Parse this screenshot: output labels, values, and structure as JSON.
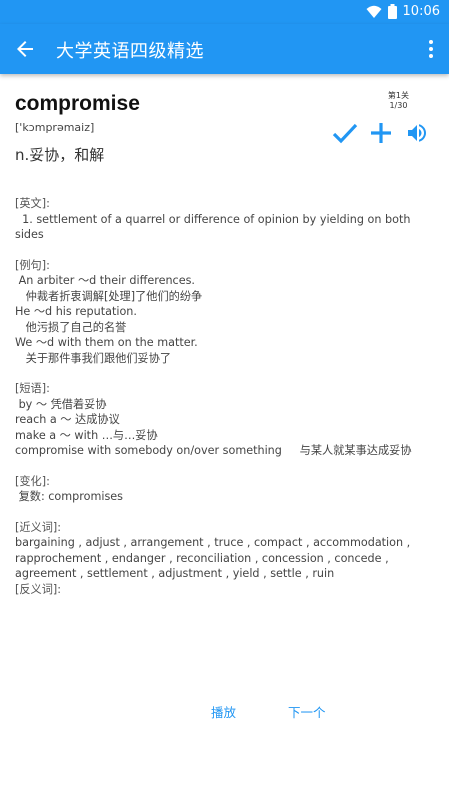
{
  "status": {
    "time": "10:06"
  },
  "app_bar": {
    "title": "大学英语四级精选"
  },
  "word": {
    "text": "compromise",
    "phonetic": "['kɔmprəmaiz]",
    "meaning": "n.妥协，和解"
  },
  "level": {
    "label": "第1关",
    "progress": "1/30"
  },
  "sections": {
    "english": {
      "header": "[英文]:",
      "lines": [
        "  1. settlement of a quarrel or difference of opinion by yielding on both sides"
      ]
    },
    "examples": {
      "header": "[例句]:",
      "lines": [
        " An arbiter ～d their differences.",
        "   仲裁者折衷调解[处理]了他们的纷争",
        "He ～d his reputation.",
        "   他污损了自己的名誉",
        "We ～d with them on the matter.",
        "   关于那件事我们跟他们妥协了"
      ]
    },
    "phrases": {
      "header": "[短语]:",
      "lines": [
        " by ～ 凭借着妥协",
        "reach a ～ 达成协议",
        "make a ～ with …与…妥协",
        "compromise with somebody on/over something     与某人就某事达成妥协"
      ]
    },
    "inflections": {
      "header": "[变化]:",
      "lines": [
        " 复数: compromises"
      ]
    },
    "synonyms": {
      "header": "[近义词]:",
      "lines": [
        "bargaining , adjust , arrangement , truce , compact , accommodation , rapprochement , endanger , reconciliation , concession , concede , agreement , settlement , adjustment , yield , settle , ruin"
      ]
    },
    "antonyms": {
      "header": "[反义词]:"
    }
  },
  "buttons": {
    "play": "播放",
    "next": "下一个"
  },
  "colors": {
    "primary": "#2196F3"
  }
}
